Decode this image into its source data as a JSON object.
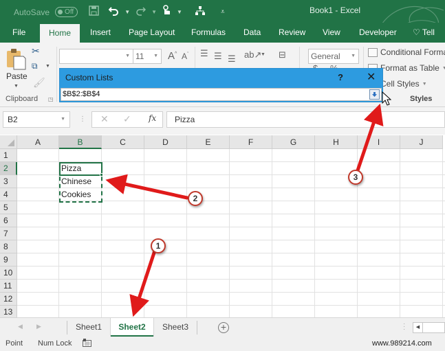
{
  "titlebar": {
    "autosave_label": "AutoSave",
    "autosave_state": "Off",
    "document_title": "Book1  -  Excel",
    "qat_icons": [
      "save-icon",
      "undo-icon",
      "redo-icon",
      "touch-mode-icon",
      "org-chart-icon",
      "customize-qat-icon"
    ]
  },
  "tabs": [
    {
      "label": "File",
      "active": false
    },
    {
      "label": "Home",
      "active": true
    },
    {
      "label": "Insert",
      "active": false
    },
    {
      "label": "Page Layout",
      "active": false
    },
    {
      "label": "Formulas",
      "active": false
    },
    {
      "label": "Data",
      "active": false
    },
    {
      "label": "Review",
      "active": false
    },
    {
      "label": "View",
      "active": false
    },
    {
      "label": "Developer",
      "active": false
    },
    {
      "label": "Tell me",
      "active": false
    }
  ],
  "ribbon": {
    "clipboard": {
      "paste_label": "Paste",
      "group_label": "Clipboard"
    },
    "font": {
      "font_name": "",
      "font_size": "11",
      "grow_label": "A",
      "shrink_label": "A"
    },
    "number": {
      "format": "General",
      "currency_symbol": "$",
      "percent_symbol": "%"
    },
    "styles": {
      "conditional_formatting": "Conditional Forma",
      "format_as_table": "Format as Table",
      "cell_styles": "Cell Styles",
      "group_label": "Styles"
    }
  },
  "dialog": {
    "title": "Custom Lists",
    "help_label": "?",
    "close_label": "✕",
    "range_value": "$B$2:$B$4"
  },
  "formula_bar": {
    "name_box": "B2",
    "cancel_label": "✕",
    "enter_label": "✓",
    "fx_label": "fx",
    "formula": "Pizza"
  },
  "grid": {
    "columns": [
      "A",
      "B",
      "C",
      "D",
      "E",
      "F",
      "G",
      "H",
      "I",
      "J"
    ],
    "rows": [
      "1",
      "2",
      "3",
      "4",
      "5",
      "6",
      "7",
      "8",
      "9",
      "10",
      "11",
      "12",
      "13"
    ],
    "selected_column": "B",
    "selected_row": "2",
    "cells": [
      {
        "ref": "B2",
        "value": "Pizza"
      },
      {
        "ref": "B3",
        "value": "Chinese"
      },
      {
        "ref": "B4",
        "value": "Cookies"
      }
    ]
  },
  "sheets": {
    "tabs": [
      {
        "label": "Sheet1",
        "active": false
      },
      {
        "label": "Sheet2",
        "active": true
      },
      {
        "label": "Sheet3",
        "active": false
      }
    ],
    "add_label": "+"
  },
  "statusbar": {
    "mode": "Point",
    "num_lock": "Num Lock",
    "watermark": "www.989214.com"
  },
  "annotations": [
    {
      "number": "1",
      "target": "Sheet2 tab"
    },
    {
      "number": "2",
      "target": "Selected list range B2:B4"
    },
    {
      "number": "3",
      "target": "Collapse dialog button"
    }
  ],
  "colors": {
    "excel_green": "#217346",
    "dialog_blue": "#2d9be0",
    "annotation_red": "#e01a1a"
  }
}
